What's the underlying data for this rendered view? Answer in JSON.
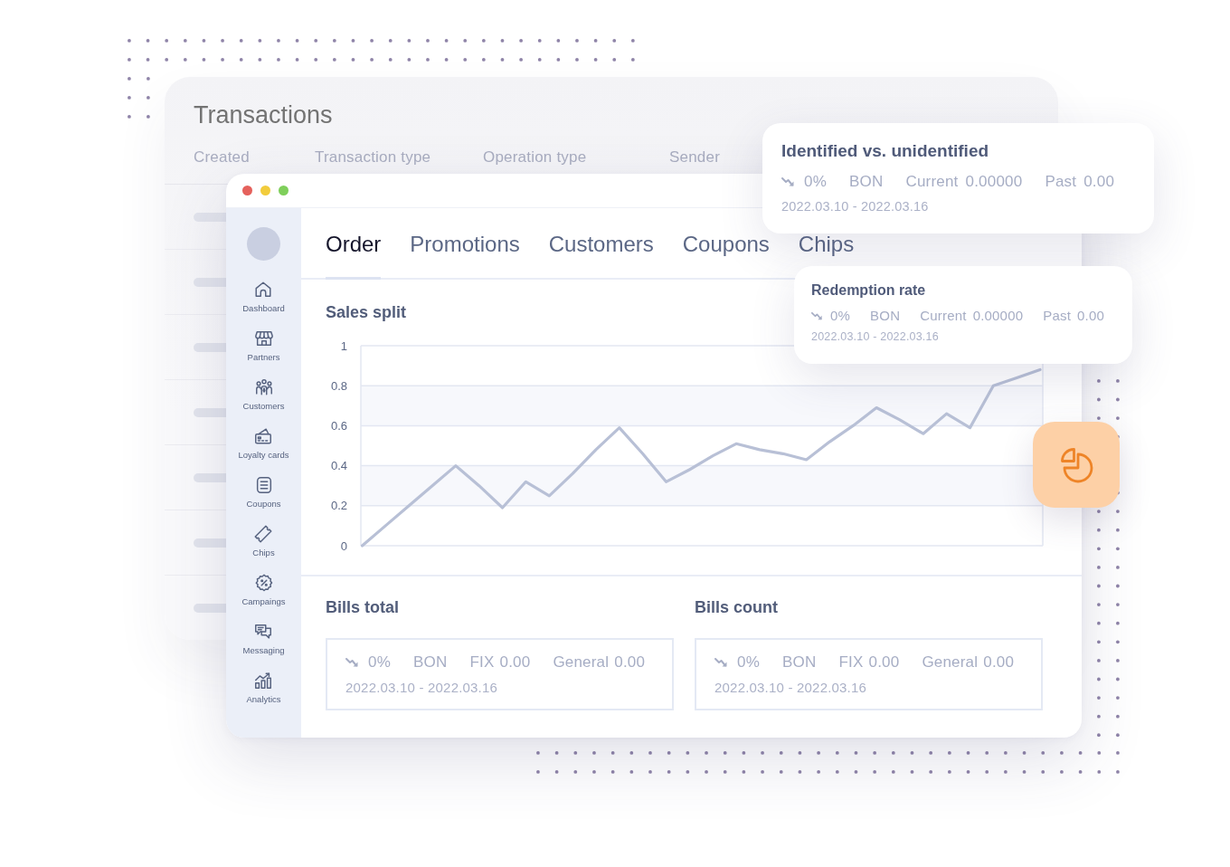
{
  "transactions": {
    "title": "Transactions",
    "columns": [
      "Created",
      "Transaction type",
      "Operation type",
      "Sender"
    ],
    "rows": [
      {
        "kind": "skeleton"
      },
      {
        "kind": "skeleton"
      },
      {
        "kind": "skeleton"
      },
      {
        "kind": "skeleton"
      },
      {
        "kind": "skeleton"
      },
      {
        "kind": "skeleton"
      },
      {
        "kind": "skeleton"
      }
    ]
  },
  "app_window": {
    "sidebar": {
      "items": [
        {
          "label": "Dashboard",
          "selected": false
        },
        {
          "label": "Partners",
          "selected": false
        },
        {
          "label": "Customers",
          "selected": false
        },
        {
          "label": "Loyalty cards",
          "selected": false
        },
        {
          "label": "Coupons",
          "selected": false
        },
        {
          "label": "Chips",
          "selected": false
        },
        {
          "label": "Campaings",
          "selected": false
        },
        {
          "label": "Messaging",
          "selected": false
        },
        {
          "label": "Analytics",
          "selected": false
        }
      ]
    },
    "tabs": [
      {
        "label": "Order",
        "selected": true
      },
      {
        "label": "Promotions",
        "selected": false
      },
      {
        "label": "Customers",
        "selected": false
      },
      {
        "label": "Coupons",
        "selected": false
      },
      {
        "label": "Chips",
        "selected": false
      }
    ],
    "sales_split": {
      "chart_data": {
        "type": "line",
        "title": "Sales split",
        "categories": [
          null,
          null,
          null,
          null,
          null,
          null,
          null,
          null,
          null,
          null,
          null,
          null,
          null,
          null,
          null,
          null,
          null,
          null,
          null,
          null,
          null,
          null,
          null,
          null,
          null,
          null,
          null,
          null,
          null,
          null
        ],
        "values": [
          0,
          0.1,
          0.2,
          0.3,
          0.4,
          0.3,
          0.19,
          0.32,
          0.25,
          0.36,
          0.48,
          0.59,
          0.46,
          0.32,
          0.38,
          0.45,
          0.51,
          0.48,
          0.46,
          0.43,
          0.52,
          0.6,
          0.69,
          0.63,
          0.56,
          0.66,
          0.59,
          0.8,
          0.84,
          0.88
        ],
        "ylim": [
          0,
          1
        ],
        "yticks": [
          0,
          0.2,
          0.4,
          0.6,
          0.8,
          1
        ],
        "grid": true
      }
    },
    "bills": [
      {
        "title": "Bills total",
        "trend_down": true,
        "change": "0%",
        "code": "BON",
        "metrics": [
          {
            "label": "FIX",
            "value": "0.00"
          },
          {
            "label": "General",
            "value": "0.00"
          }
        ],
        "date_range": "2022.03.10 - 2022.03.16"
      },
      {
        "title": "Bills count",
        "trend_down": true,
        "change": "0%",
        "code": "BON",
        "metrics": [
          {
            "label": "FIX",
            "value": "0.00"
          },
          {
            "label": "General",
            "value": "0.00"
          }
        ],
        "date_range": "2022.03.10 - 2022.03.16"
      }
    ]
  },
  "cards": [
    {
      "title": "Identified vs. unidentified",
      "trend_down": true,
      "change": "0%",
      "code": "BON",
      "metrics": [
        {
          "label": "Current",
          "value": "0.00000"
        },
        {
          "label": "Past",
          "value": "0.00"
        }
      ],
      "date_range": "2022.03.10 - 2022.03.16"
    },
    {
      "title": "Redemption rate",
      "trend_down": true,
      "change": "0%",
      "code": "BON",
      "metrics": [
        {
          "label": "Current",
          "value": "0.00000"
        },
        {
          "label": "Past",
          "value": "0.00"
        }
      ],
      "date_range": "2022.03.10 - 2022.03.16"
    }
  ]
}
